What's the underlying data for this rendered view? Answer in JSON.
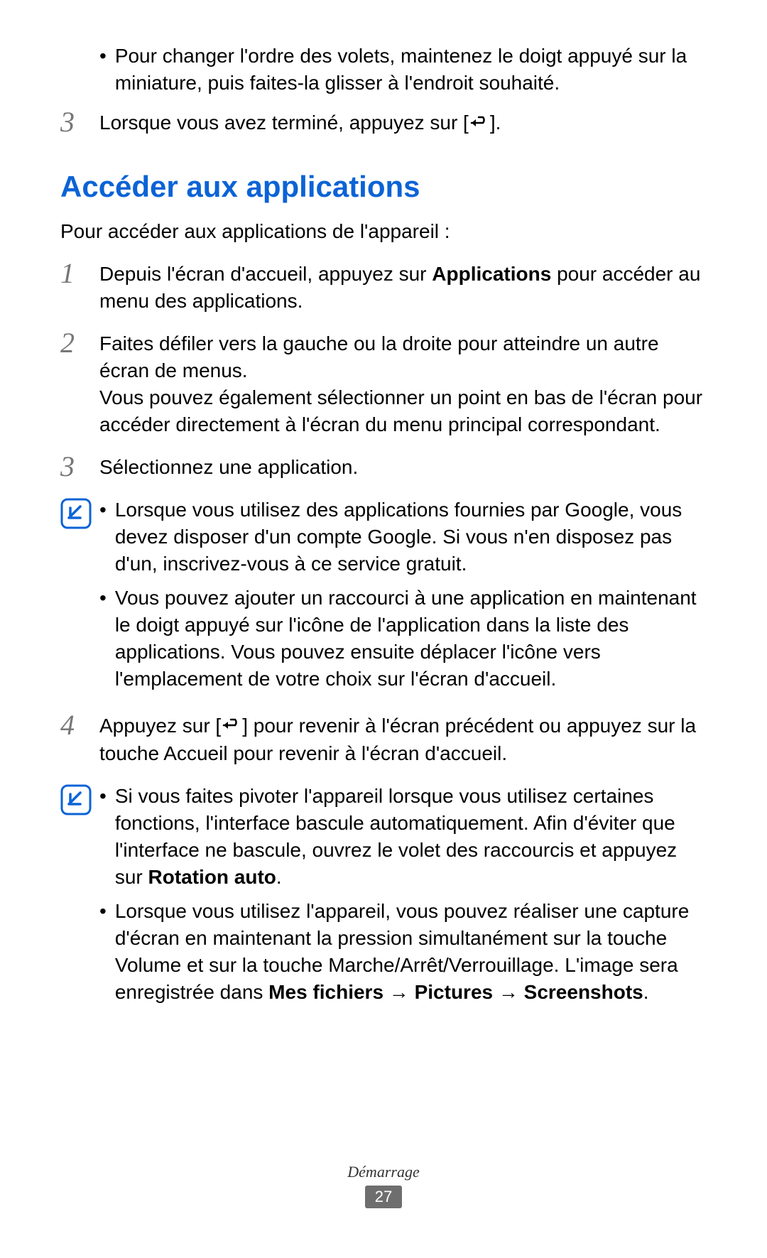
{
  "topBullet": "Pour changer l'ordre des volets, maintenez le doigt appuyé sur la miniature, puis faites-la glisser à l'endroit souhaité.",
  "step3a_pre": "Lorsque vous avez terminé, appuyez sur [",
  "step3a_post": "].",
  "sectionTitle": "Accéder aux applications",
  "intro": "Pour accéder aux applications de l'appareil :",
  "step1_pre": "Depuis l'écran d'accueil, appuyez sur ",
  "step1_bold": "Applications",
  "step1_post": " pour accéder au menu des applications.",
  "step2_p1": "Faites défiler vers la gauche ou la droite pour atteindre un autre écran de menus.",
  "step2_p2": "Vous pouvez également sélectionner un point en bas de l'écran pour accéder directement à l'écran du menu principal correspondant.",
  "step3b": "Sélectionnez une application.",
  "note1_b1": "Lorsque vous utilisez des applications fournies par Google, vous devez disposer d'un compte Google. Si vous n'en disposez pas d'un, inscrivez-vous à ce service gratuit.",
  "note1_b2": "Vous pouvez ajouter un raccourci à une application en maintenant le doigt appuyé sur l'icône de l'application dans la liste des applications. Vous pouvez ensuite déplacer l'icône vers l'emplacement de votre choix sur l'écran d'accueil.",
  "step4_pre": "Appuyez sur [",
  "step4_post": "] pour revenir à l'écran précédent ou appuyez sur la touche Accueil pour revenir à l'écran d'accueil.",
  "note2_b1_pre": "Si vous faites pivoter l'appareil lorsque vous utilisez certaines fonctions, l'interface bascule automatiquement. Afin d'éviter que l'interface ne bascule, ouvrez le volet des raccourcis et appuyez sur ",
  "note2_b1_bold": "Rotation auto",
  "note2_b1_post": ".",
  "note2_b2_pre": "Lorsque vous utilisez l'appareil, vous pouvez réaliser une capture d'écran en maintenant la pression simultanément sur la touche Volume et sur la touche Marche/Arrêt/Verrouillage. L'image sera enregistrée dans ",
  "note2_b2_bold1": "Mes fichiers",
  "note2_b2_arrow1": " → ",
  "note2_b2_bold2": "Pictures",
  "note2_b2_arrow2": " → ",
  "note2_b2_bold3": "Screenshots",
  "note2_b2_post": ".",
  "footerSection": "Démarrage",
  "pageNumber": "27",
  "nums": {
    "n1": "1",
    "n2": "2",
    "n3": "3",
    "n4": "4"
  }
}
